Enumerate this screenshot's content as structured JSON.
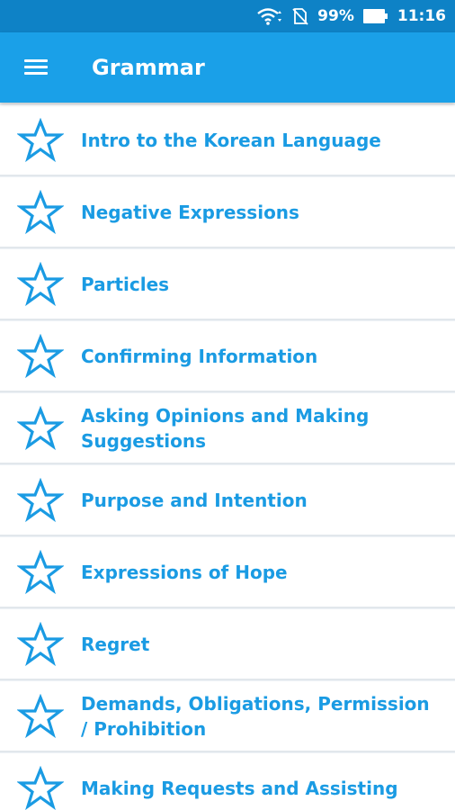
{
  "status_bar": {
    "battery": "99%",
    "time": "11:16"
  },
  "app_bar": {
    "title": "Grammar"
  },
  "colors": {
    "status_bar": "#0e82c6",
    "app_bar": "#1aa0e8",
    "accent": "#1a9be3"
  },
  "list": {
    "items": [
      {
        "label": "Intro to the Korean Language",
        "icon": "star-outline-icon"
      },
      {
        "label": "Negative Expressions",
        "icon": "star-outline-icon"
      },
      {
        "label": "Particles",
        "icon": "star-outline-icon"
      },
      {
        "label": "Confirming Information",
        "icon": "star-outline-icon"
      },
      {
        "label": "Asking Opinions and Making Suggestions",
        "icon": "star-outline-icon"
      },
      {
        "label": "Purpose and Intention",
        "icon": "star-outline-icon"
      },
      {
        "label": "Expressions of Hope",
        "icon": "star-outline-icon"
      },
      {
        "label": "Regret",
        "icon": "star-outline-icon"
      },
      {
        "label": "Demands, Obligations, Permission / Prohibition",
        "icon": "star-outline-icon"
      },
      {
        "label": "Making Requests and Assisting",
        "icon": "star-outline-icon"
      }
    ]
  }
}
